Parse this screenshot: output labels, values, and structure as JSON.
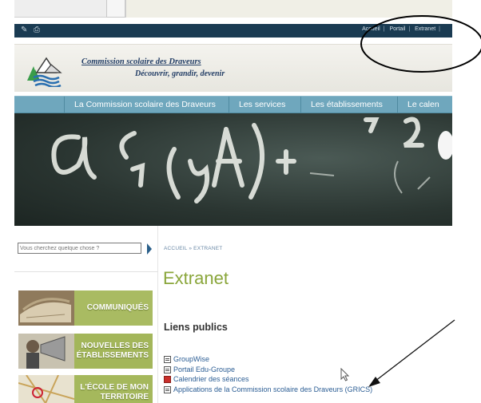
{
  "topbar": {
    "edit_icon": "edit-icon",
    "print_icon": "print-icon",
    "links": [
      "Accueil",
      "Portail",
      "Extranet"
    ]
  },
  "brand": {
    "name": "Commission scolaire des Draveurs",
    "tagline": "Découvrir, grandir, devenir"
  },
  "nav": {
    "items": [
      "La Commission scolaire des Draveurs",
      "Les services",
      "Les établissements",
      "Le calen"
    ]
  },
  "sidebar": {
    "search_placeholder": "Vous cherchez quelque chose ?",
    "tiles": [
      {
        "label": "COMMUNIQUÉS"
      },
      {
        "label": "NOUVELLES DES ÉTABLISSEMENTS"
      },
      {
        "label": "L'ÉCOLE DE MON TERRITOIRE"
      }
    ]
  },
  "main": {
    "breadcrumb": "ACCUEIL » EXTRANET",
    "title": "Extranet",
    "section_title": "Liens publics",
    "links": [
      {
        "label": "GroupWise",
        "icon": "document-icon"
      },
      {
        "label": "Portail Edu-Groupe",
        "icon": "document-icon"
      },
      {
        "label": "Calendrier des séances",
        "icon": "pdf-icon"
      },
      {
        "label": "Applications de la Commission scolaire des Draveurs (GRICS)",
        "icon": "document-icon"
      }
    ]
  },
  "colors": {
    "topbar": "#1a3b52",
    "nav": "#6fa7bd",
    "title_green": "#8aa63b",
    "tile_green": "#a3b65a",
    "link_blue": "#2b5d94"
  }
}
